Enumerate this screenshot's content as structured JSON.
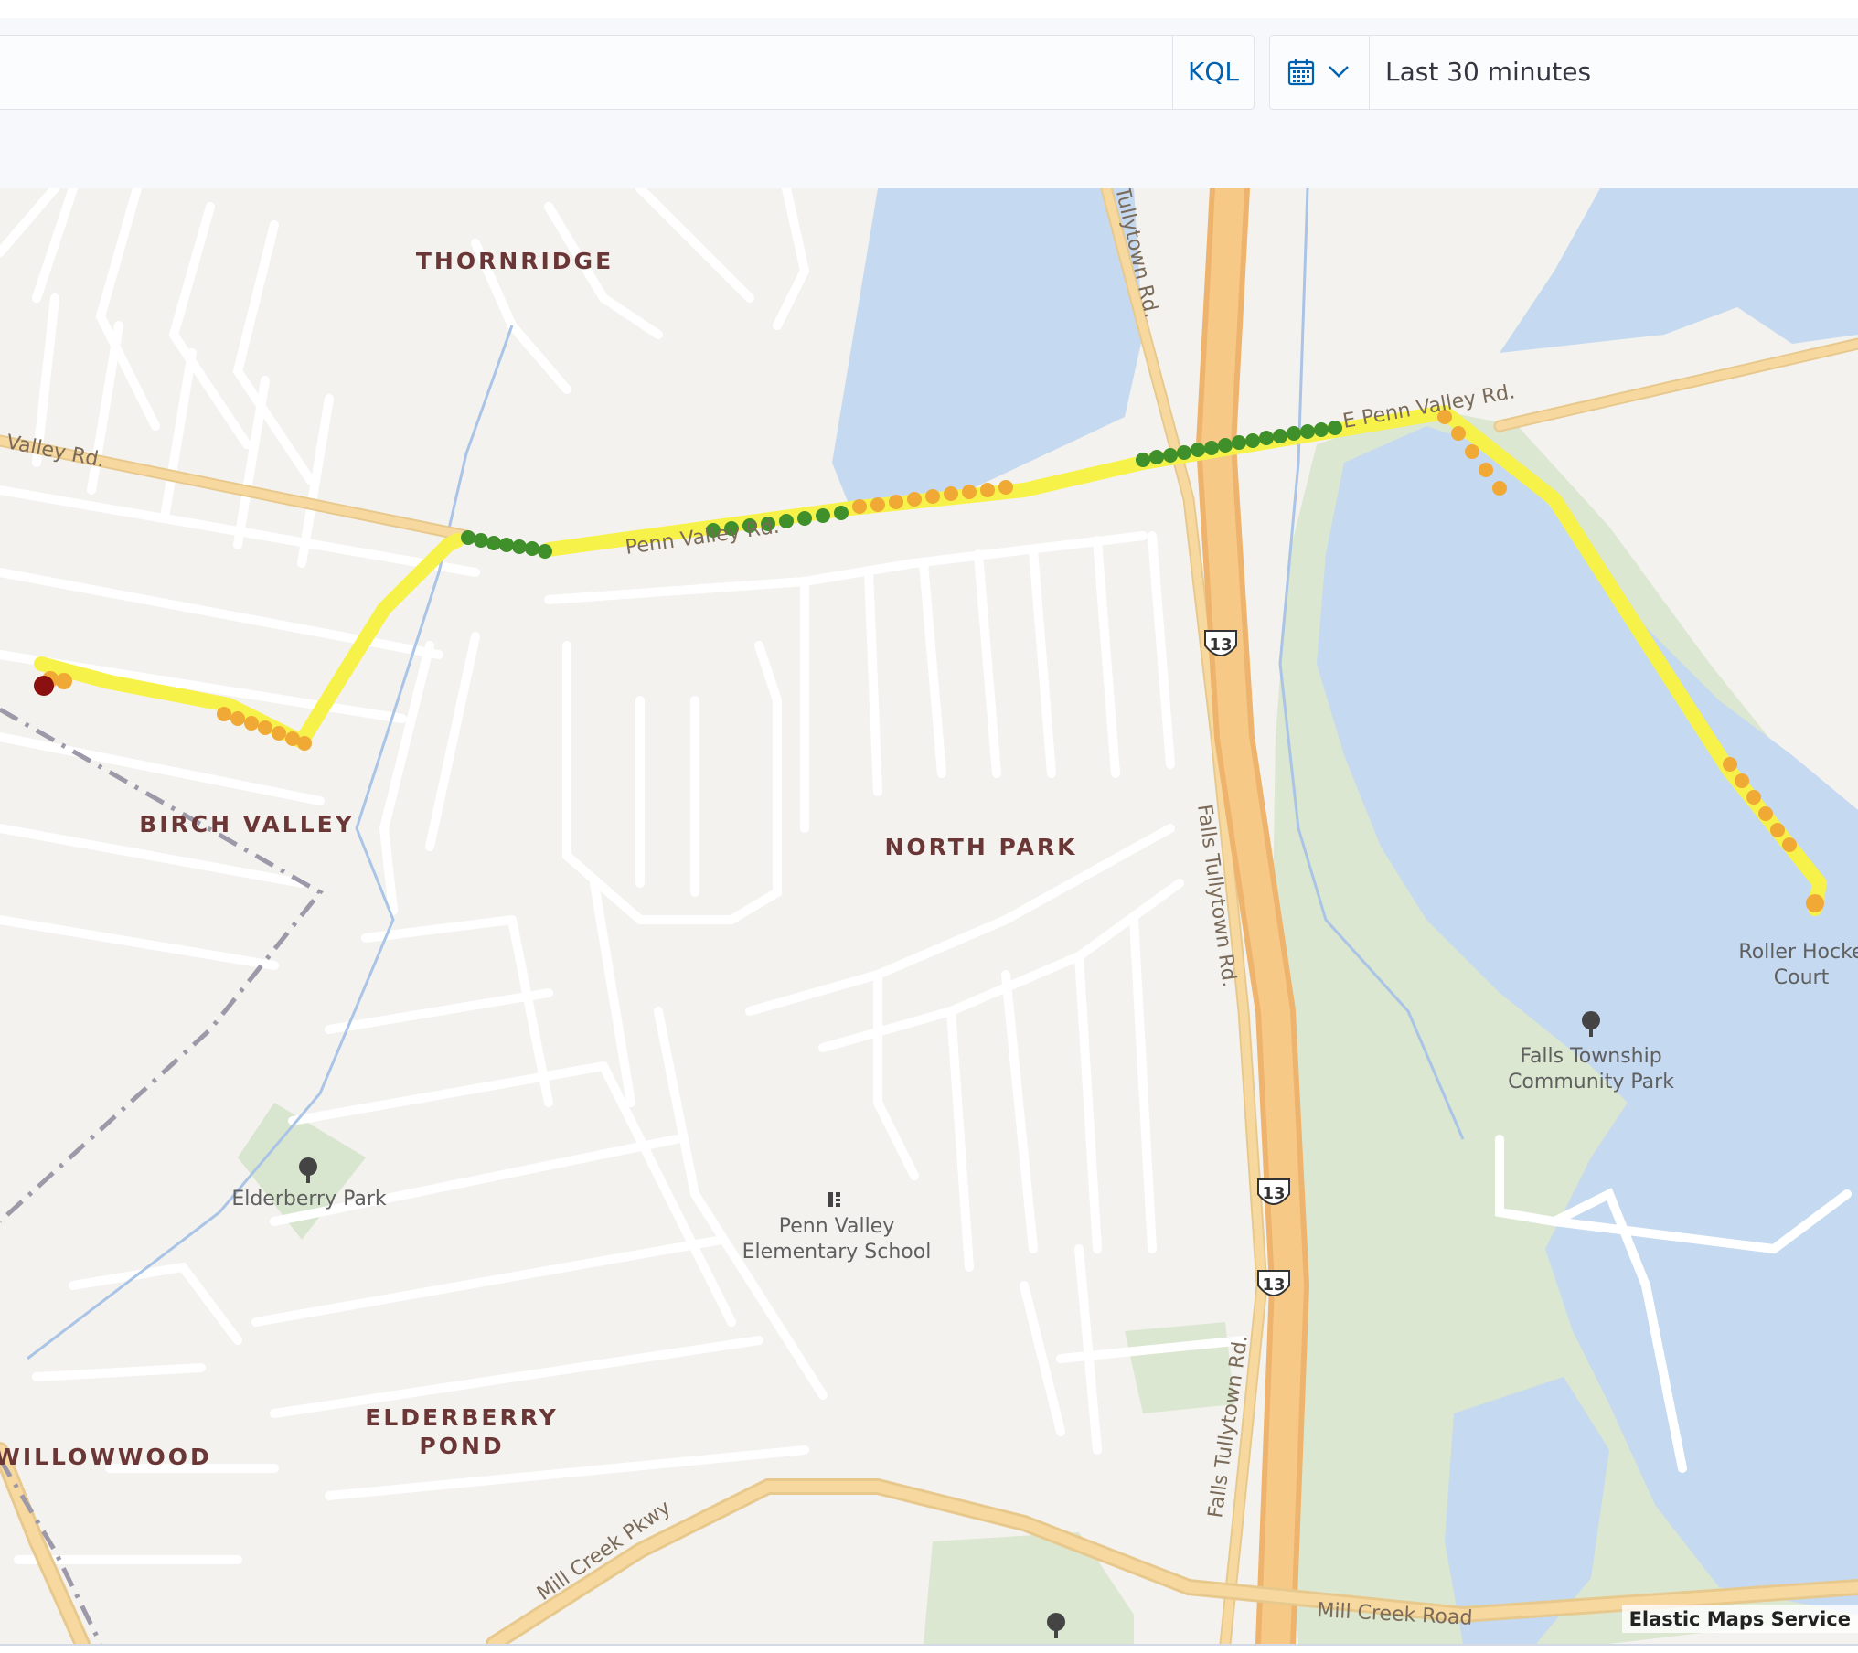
{
  "query_bar": {
    "language_label": "KQL",
    "time_range": "Last 30 minutes",
    "calendar_icon": "calendar-icon",
    "dropdown_icon": "chevron-down-icon"
  },
  "map": {
    "neighborhoods": [
      "THORNRIDGE",
      "BIRCH VALLEY",
      "NORTH PARK",
      "ELDERBERRY",
      "POND",
      "WILLOWWOOD"
    ],
    "pois": {
      "elderberry_park": "Elderberry Park",
      "school_line1": "Penn Valley",
      "school_line2": "Elementary School",
      "park_line1": "Falls Township",
      "park_line2": "Community Park",
      "court_line1": "Roller Hocke",
      "court_line2": "Court"
    },
    "roads": {
      "valley_rd_left": "Valley Rd.",
      "penn_valley_mid": "Penn Valley Rd.",
      "penn_valley_right": "E Penn Valley Rd.",
      "tullytown_top": "Tullytown Rd.",
      "falls_tullytown_mid": "Falls Tullytown Rd.",
      "falls_tullytown_bottom": "Falls Tullytown Rd.",
      "mill_creek_pkwy": "Mill Creek Pkwy",
      "mill_creek_road": "Mill Creek Road"
    },
    "shields": [
      "13",
      "13",
      "13"
    ],
    "attribution": "Elastic Maps Service",
    "track_colors": {
      "slow": "#f7f24a",
      "medium": "#f0a935",
      "fast": "#3f8f2a",
      "start": "#8b1010"
    }
  }
}
